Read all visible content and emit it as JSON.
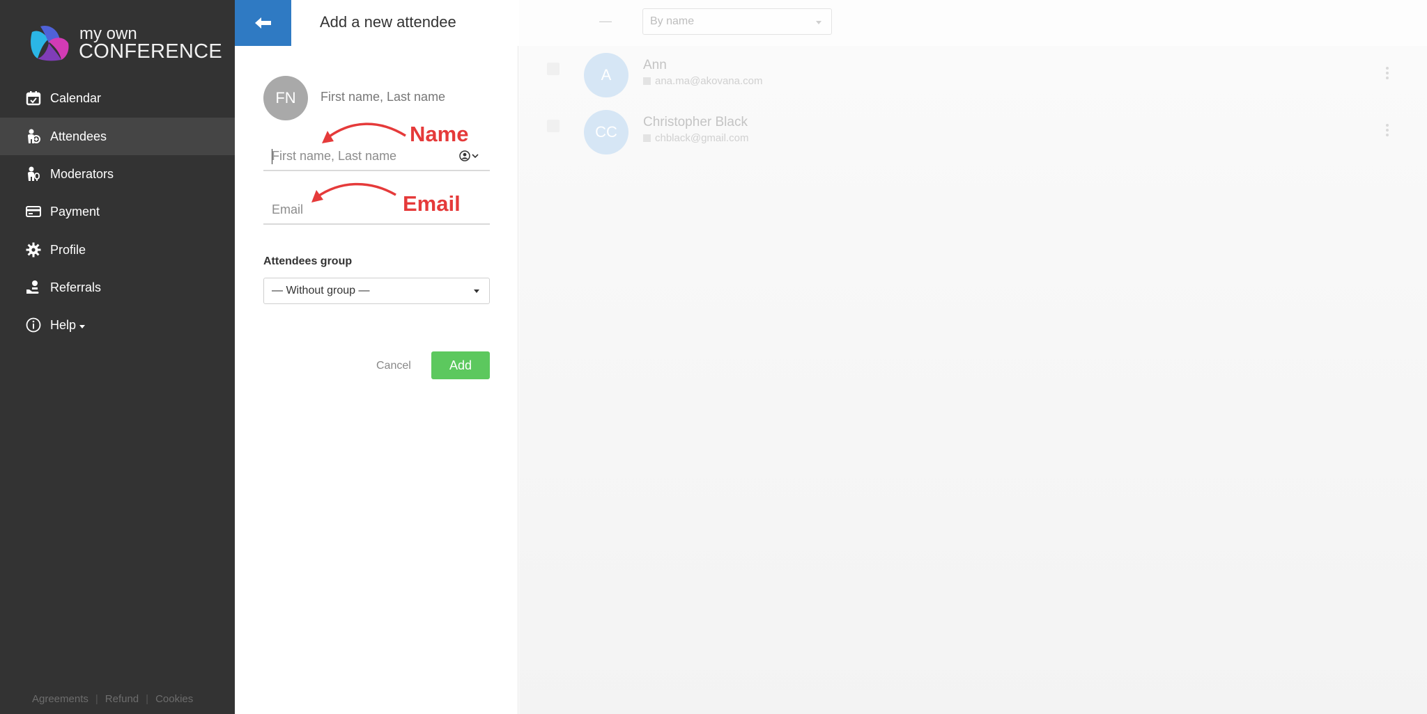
{
  "app": {
    "logo_line1": "my own",
    "logo_line2": "CONFERENCE"
  },
  "sidebar": {
    "items": [
      {
        "label": "Calendar",
        "icon": "calendar-icon"
      },
      {
        "label": "Attendees",
        "icon": "attendees-icon",
        "active": true
      },
      {
        "label": "Moderators",
        "icon": "moderators-icon"
      },
      {
        "label": "Payment",
        "icon": "credit-card-icon"
      },
      {
        "label": "Profile",
        "icon": "gear-icon"
      },
      {
        "label": "Referrals",
        "icon": "referrals-icon"
      },
      {
        "label": "Help",
        "icon": "info-icon"
      }
    ],
    "footer": {
      "agreements": "Agreements",
      "refund": "Refund",
      "cookies": "Cookies"
    }
  },
  "header": {
    "title": "Add a new attendee",
    "sort_dash": "—",
    "sort_placeholder": "By name"
  },
  "form": {
    "avatar_initials": "FN",
    "preview_name": "First name, Last name",
    "name_placeholder": "First name, Last name",
    "email_placeholder": "Email",
    "group_label": "Attendees group",
    "group_value": "— Without group —",
    "cancel_label": "Cancel",
    "add_label": "Add"
  },
  "annotations": {
    "name": "Name",
    "email": "Email",
    "color": "#e53a3a"
  },
  "attendees": [
    {
      "initials": "A",
      "name": "Ann",
      "email": "ana.ma@akovana.com"
    },
    {
      "initials": "CC",
      "name": "Christopher Black",
      "email": "chblack@gmail.com"
    }
  ],
  "colors": {
    "sidebar_bg": "#333333",
    "accent_blue": "#2f7ac3",
    "add_green": "#5cc85e"
  }
}
